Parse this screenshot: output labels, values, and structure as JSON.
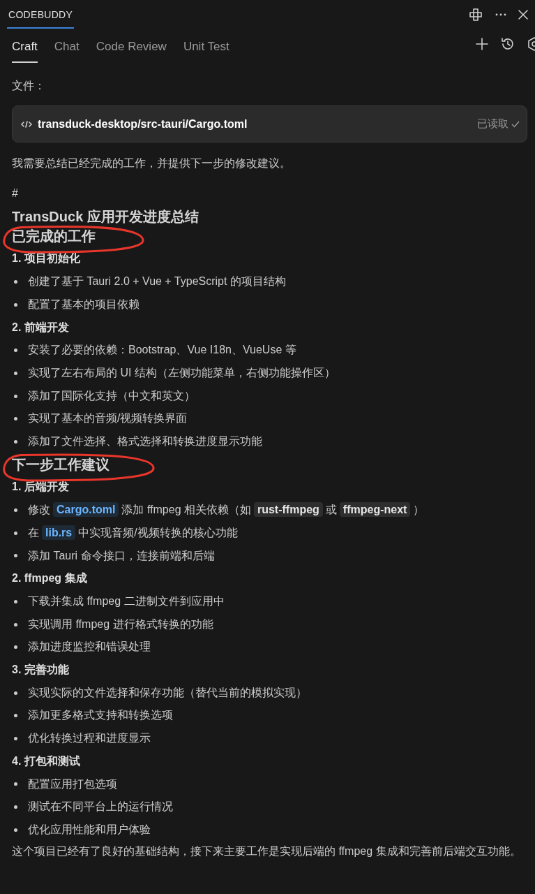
{
  "header": {
    "title": "CODEBUDDY"
  },
  "tabs": [
    {
      "label": "Craft",
      "selected": true
    },
    {
      "label": "Chat",
      "selected": false
    },
    {
      "label": "Code Review",
      "selected": false
    },
    {
      "label": "Unit Test",
      "selected": false
    }
  ],
  "files_label": "文件：",
  "file_card": {
    "path": "transduck-desktop/src-tauri/Cargo.toml",
    "status": "已读取"
  },
  "blocks": [
    {
      "kind": "para",
      "segments": [
        {
          "kind": "plain",
          "text": "我需要总结已经完成的工作，并提供下一步的修改建议。"
        }
      ]
    },
    {
      "kind": "hash",
      "segments": [
        {
          "kind": "plain",
          "text": "#"
        }
      ]
    },
    {
      "kind": "heading",
      "segments": [
        {
          "kind": "plain",
          "text": "TransDuck 应用开发进度总结"
        }
      ]
    },
    {
      "kind": "heading",
      "segments": [
        {
          "kind": "plain",
          "text": "已完成的工作"
        }
      ]
    },
    {
      "kind": "numbered",
      "segments": [
        {
          "kind": "plain",
          "text": "1. 项目初始化"
        }
      ]
    },
    {
      "kind": "bullet",
      "segments": [
        {
          "kind": "plain",
          "text": "创建了基于 Tauri 2.0 + Vue + TypeScript 的项目结构"
        }
      ]
    },
    {
      "kind": "bullet",
      "segments": [
        {
          "kind": "plain",
          "text": "配置了基本的项目依赖"
        }
      ]
    },
    {
      "kind": "numbered",
      "segments": [
        {
          "kind": "plain",
          "text": "2. 前端开发"
        }
      ]
    },
    {
      "kind": "bullet",
      "segments": [
        {
          "kind": "plain",
          "text": "安装了必要的依赖：Bootstrap、Vue I18n、VueUse 等"
        }
      ]
    },
    {
      "kind": "bullet",
      "segments": [
        {
          "kind": "plain",
          "text": "实现了左右布局的 UI 结构（左侧功能菜单，右侧功能操作区）"
        }
      ]
    },
    {
      "kind": "bullet",
      "segments": [
        {
          "kind": "plain",
          "text": "添加了国际化支持（中文和英文）"
        }
      ]
    },
    {
      "kind": "bullet",
      "segments": [
        {
          "kind": "plain",
          "text": "实现了基本的音频/视频转换界面"
        }
      ]
    },
    {
      "kind": "bullet",
      "segments": [
        {
          "kind": "plain",
          "text": "添加了文件选择、格式选择和转换进度显示功能"
        }
      ]
    },
    {
      "kind": "heading",
      "segments": [
        {
          "kind": "plain",
          "text": "下一步工作建议"
        }
      ]
    },
    {
      "kind": "numbered",
      "segments": [
        {
          "kind": "plain",
          "text": "1. 后端开发"
        }
      ]
    },
    {
      "kind": "bullet",
      "segments": [
        {
          "kind": "plain",
          "text": "修改"
        },
        {
          "kind": "file-link",
          "text": "Cargo.toml"
        },
        {
          "kind": "plain",
          "text": "添加 ffmpeg 相关依赖（如"
        },
        {
          "kind": "code",
          "text": "rust-ffmpeg"
        },
        {
          "kind": "plain",
          "text": "或"
        },
        {
          "kind": "code",
          "text": "ffmpeg-next"
        },
        {
          "kind": "plain",
          "text": "）"
        }
      ]
    },
    {
      "kind": "bullet",
      "segments": [
        {
          "kind": "plain",
          "text": "在"
        },
        {
          "kind": "file-link",
          "text": "lib.rs"
        },
        {
          "kind": "plain",
          "text": "中实现音频/视频转换的核心功能"
        }
      ]
    },
    {
      "kind": "bullet",
      "segments": [
        {
          "kind": "plain",
          "text": "添加 Tauri 命令接口，连接前端和后端"
        }
      ]
    },
    {
      "kind": "numbered",
      "segments": [
        {
          "kind": "plain",
          "text": "2. ffmpeg 集成"
        }
      ]
    },
    {
      "kind": "bullet",
      "segments": [
        {
          "kind": "plain",
          "text": "下载并集成 ffmpeg 二进制文件到应用中"
        }
      ]
    },
    {
      "kind": "bullet",
      "segments": [
        {
          "kind": "plain",
          "text": "实现调用 ffmpeg 进行格式转换的功能"
        }
      ]
    },
    {
      "kind": "bullet",
      "segments": [
        {
          "kind": "plain",
          "text": "添加进度监控和错误处理"
        }
      ]
    },
    {
      "kind": "numbered",
      "segments": [
        {
          "kind": "plain",
          "text": "3. 完善功能"
        }
      ]
    },
    {
      "kind": "bullet",
      "segments": [
        {
          "kind": "plain",
          "text": "实现实际的文件选择和保存功能（替代当前的模拟实现）"
        }
      ]
    },
    {
      "kind": "bullet",
      "segments": [
        {
          "kind": "plain",
          "text": "添加更多格式支持和转换选项"
        }
      ]
    },
    {
      "kind": "bullet",
      "segments": [
        {
          "kind": "plain",
          "text": "优化转换过程和进度显示"
        }
      ]
    },
    {
      "kind": "numbered",
      "segments": [
        {
          "kind": "plain",
          "text": "4. 打包和测试"
        }
      ]
    },
    {
      "kind": "bullet",
      "segments": [
        {
          "kind": "plain",
          "text": "配置应用打包选项"
        }
      ]
    },
    {
      "kind": "bullet",
      "segments": [
        {
          "kind": "plain",
          "text": "测试在不同平台上的运行情况"
        }
      ]
    },
    {
      "kind": "bullet",
      "segments": [
        {
          "kind": "plain",
          "text": "优化应用性能和用户体验"
        }
      ]
    },
    {
      "kind": "summary",
      "segments": [
        {
          "kind": "plain",
          "text": "这个项目已经有了良好的基础结构，接下来主要工作是实现后端的 ffmpeg 集成和完善前后端交互功能。"
        }
      ]
    }
  ],
  "annotations": [
    {
      "kind": "circle"
    },
    {
      "kind": "circle"
    }
  ]
}
